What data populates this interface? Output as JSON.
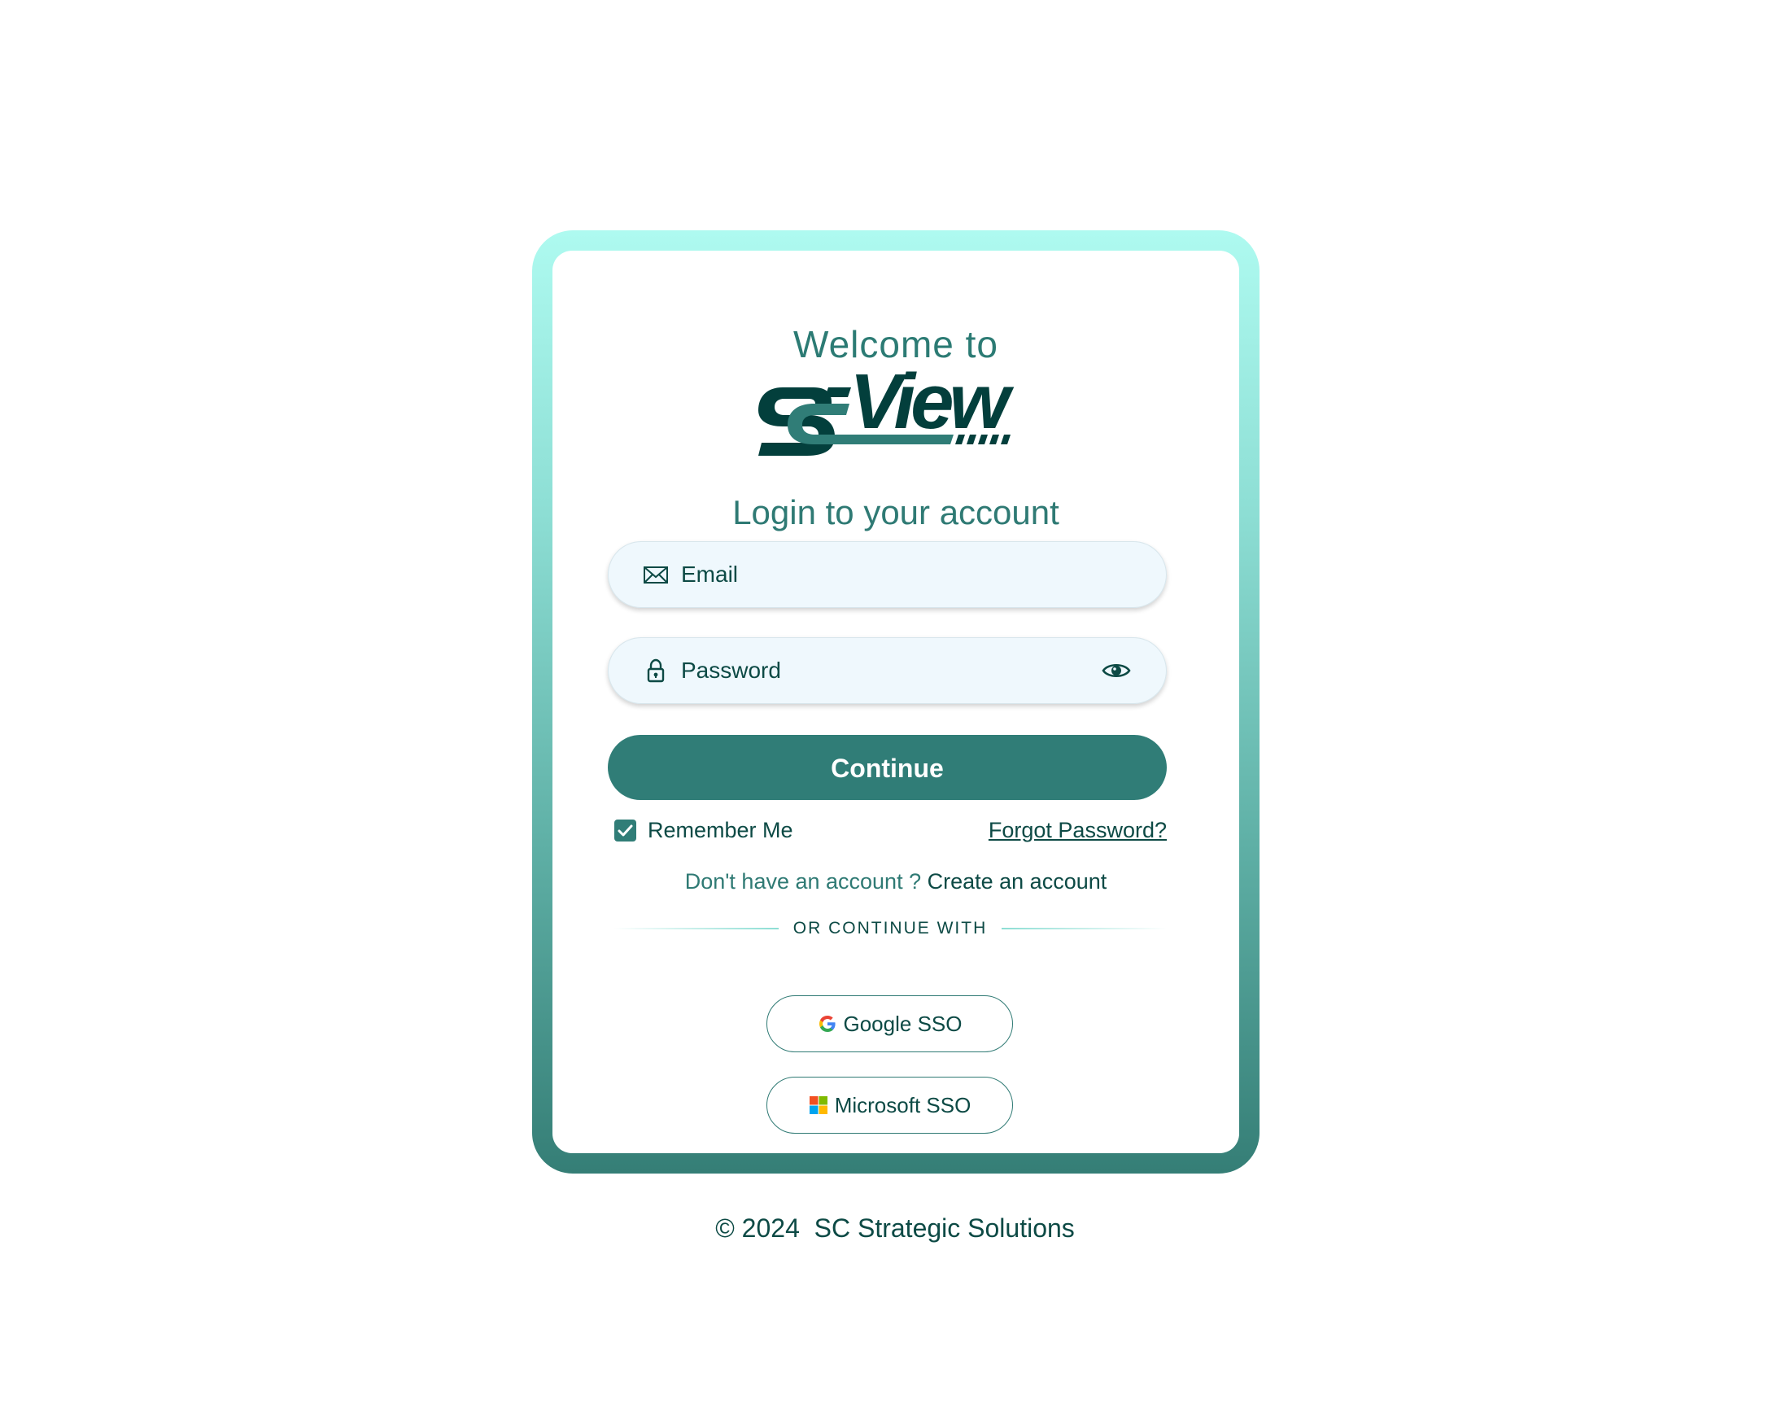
{
  "header": {
    "welcome_text": "Welcome to",
    "logo_text": "SCView",
    "subtitle": "Login to your account"
  },
  "form": {
    "email_placeholder": "Email",
    "password_placeholder": "Password",
    "continue_label": "Continue",
    "remember_label": "Remember Me",
    "remember_checked": true,
    "forgot_label": "Forgot Password?"
  },
  "signup": {
    "prompt": "Don't have an account ?",
    "link_label": "Create an account"
  },
  "sso": {
    "divider_text": "OR CONTINUE WITH",
    "google_label": "Google SSO",
    "google_icon": "google-logo-icon",
    "microsoft_label": "Microsoft SSO",
    "microsoft_icon": "microsoft-logo-icon"
  },
  "footer": {
    "copyright": "© 2024  SC Strategic Solutions"
  },
  "colors": {
    "primary": "#307d77",
    "dark_text": "#0d4a45",
    "accent_text": "#2f7a74",
    "frame_top": "#aefaf0",
    "frame_bottom": "#357e76",
    "field_bg": "#eff8fd"
  }
}
